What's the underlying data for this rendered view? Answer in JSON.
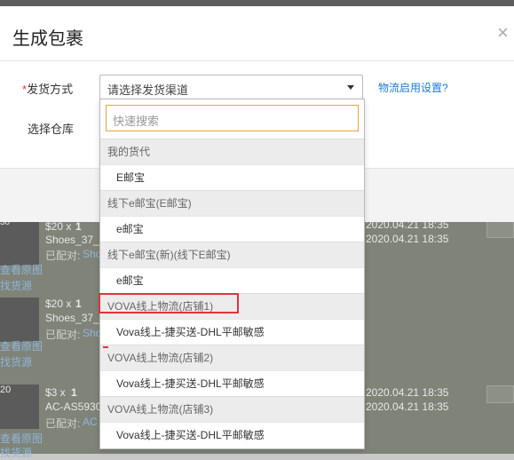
{
  "modal": {
    "title": "生成包裹",
    "close_glyph": "×",
    "ship_method_label": "发货方式",
    "required_mark": "*",
    "warehouse_label": "选择仓库",
    "select_value": "请选择发货渠道",
    "help_link": "物流启用设置?"
  },
  "dropdown": {
    "search_placeholder": "快速搜索",
    "groups": [
      {
        "label": "我的货代",
        "items": [
          "E邮宝"
        ]
      },
      {
        "label": "线下e邮宝(E邮宝)",
        "items": [
          "e邮宝"
        ]
      },
      {
        "label": "线下e邮宝(新)(线下E邮宝)",
        "items": [
          "e邮宝"
        ]
      },
      {
        "label": "VOVA线上物流(店铺1)",
        "items": [
          "Vova线上-捷买送-DHL平邮敏感"
        ]
      },
      {
        "label": "VOVA线上物流(店铺2)",
        "items": [
          "Vova线上-捷买送-DHL平邮敏感"
        ]
      },
      {
        "label": "VOVA线上物流(店铺3)",
        "items": [
          "Vova线上-捷买送-DHL平邮敏感"
        ]
      }
    ]
  },
  "background": {
    "rows": [
      {
        "price": "$20 x",
        "qty": "1",
        "sku": "Shoes_37_",
        "paired": "已配对: ",
        "paired_link": "Sho",
        "link1": "查看原图",
        "link2": "找货源",
        "date1": "2020.04.21 18:35",
        "date2": "2020.04.21 18:35",
        "badge": "30"
      },
      {
        "price": "$20 x",
        "qty": "1",
        "sku": "Shoes_37_",
        "paired": "已配对: ",
        "paired_link": "Sho",
        "link1": "查看原图",
        "link2": "找货源",
        "date1": "",
        "date2": "",
        "badge": ""
      },
      {
        "price": "$3 x",
        "qty": "1",
        "sku": "AC-AS5930",
        "paired": "已配对: ",
        "paired_link": "AC",
        "link1": "查看原图",
        "link2": "找货源",
        "date1": "2020.04.21 18:35",
        "date2": "2020.04.21 18:35",
        "badge": "20"
      }
    ]
  }
}
